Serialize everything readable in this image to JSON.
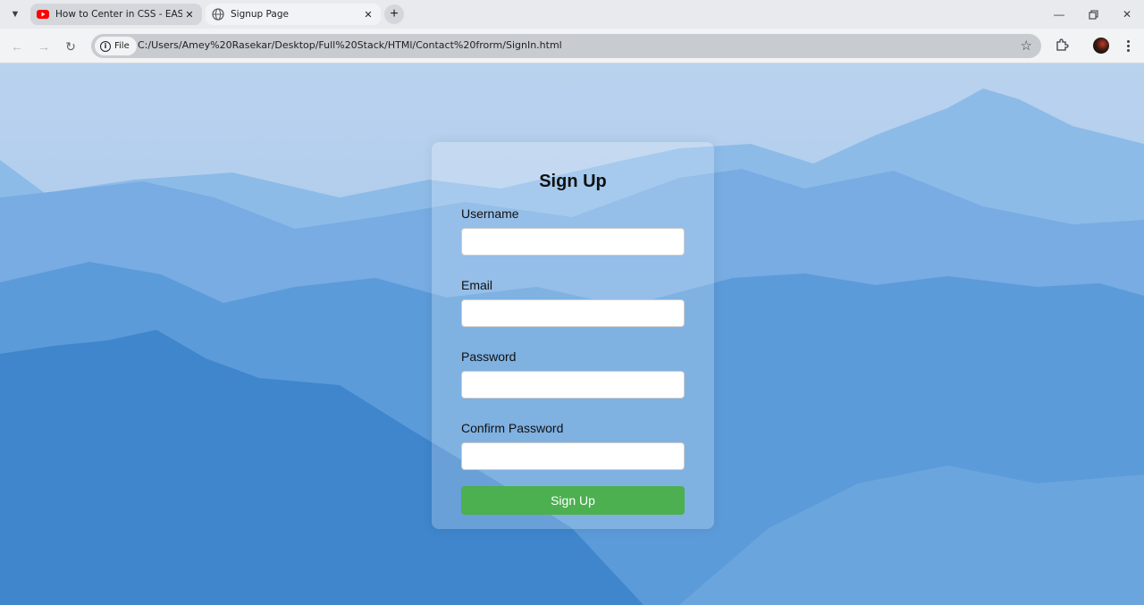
{
  "browser": {
    "tabs": [
      {
        "title": "How to Center in CSS - EASY (C",
        "favicon": "youtube-icon",
        "active": false
      },
      {
        "title": "Signup Page",
        "favicon": "globe-icon",
        "active": true
      }
    ],
    "address": {
      "chip_label": "File",
      "url": "C:/Users/Amey%20Rasekar/Desktop/Full%20Stack/HTMl/Contact%20frorm/SignIn.html"
    }
  },
  "form": {
    "title": "Sign Up",
    "username_label": "Username",
    "email_label": "Email",
    "password_label": "Password",
    "confirm_label": "Confirm Password",
    "username_value": "",
    "email_value": "",
    "password_value": "",
    "confirm_value": "",
    "submit_label": "Sign Up"
  },
  "colors": {
    "accent": "#4caf50",
    "sky": "#a9c8ea",
    "mountain": "#3f8fd6"
  }
}
